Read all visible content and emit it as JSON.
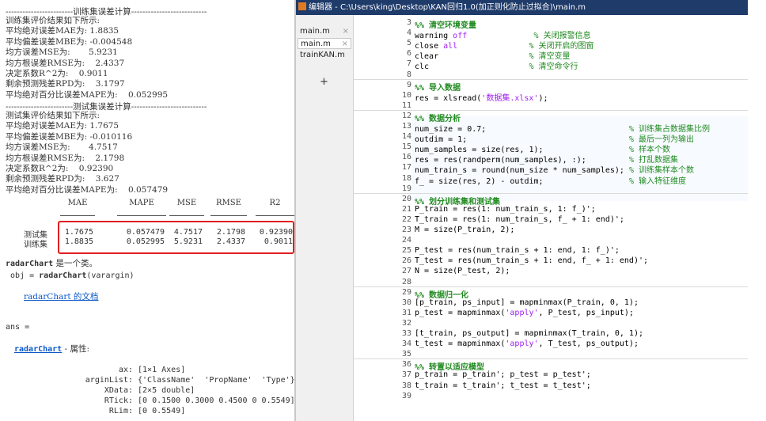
{
  "command_window": {
    "train_header": "------------------------训练集误差计算---------------------------",
    "train_lines": [
      "训练集评价结果如下所示:",
      "平均绝对误差MAE为: 1.8835",
      "平均偏差误差MBE为: -0.004548",
      "均方误差MSE为:       5.9231",
      "均方根误差RMSE为:    2.4337",
      "决定系数R^2为:    0.9011",
      "剩余预测残差RPD为:    3.1797",
      "平均绝对百分比误差MAPE为:    0.052995"
    ],
    "test_header": "------------------------测试集误差计算---------------------------",
    "test_lines": [
      "测试集评价结果如下所示:",
      "平均绝对误差MAE为: 1.7675",
      "平均偏差误差MBE为: -0.010116",
      "均方误差MSE为:       4.7517",
      "均方根误差RMSE为:    2.1798",
      "决定系数R^2为:    0.92390",
      "剩余预测残差RPD为:    3.627",
      "平均绝对百分比误差MAPE为:    0.057479"
    ],
    "table": {
      "columns": [
        "MAE",
        "MAPE",
        "MSE",
        "RMSE",
        "R2"
      ],
      "rows": [
        {
          "label": "测试集",
          "values": [
            "1.7675",
            "0.057479",
            "4.7517",
            "2.1798",
            "0.92390"
          ]
        },
        {
          "label": "训练集",
          "values": [
            "1.8835",
            "0.052995",
            "5.9231",
            "2.4337",
            "0.9011"
          ]
        }
      ]
    },
    "radar_desc_name": "radarChart",
    "radar_desc_rest": " 是一个类。",
    "radar_sig_prefix": " obj = ",
    "radar_sig_name": "radarChart",
    "radar_sig_suffix": "(varargin)",
    "radar_doc_link": "radarChart 的文档",
    "ans_line": "ans =",
    "ans_class_name": "radarChart",
    "ans_class_rest": " - 属性:",
    "props": [
      "ax: [1×1 Axes]",
      "arginList: {'ClassName'  'PropName'  'Type'}",
      "XData: [2×5 double]",
      "RTick: [0 0.1500 0.3000 0.4500 0 0.5549]",
      "RLim: [0 0.5549]"
    ]
  },
  "editor": {
    "title": "编辑器 - C:\\Users\\king\\Desktop\\KAN回归1.0(加正则化防止过拟合)\\main.m",
    "file_tabs": [
      {
        "name": "main.m",
        "active": false
      },
      {
        "name": "main.m",
        "active": true
      },
      {
        "name": "trainKAN.m",
        "active": false
      }
    ],
    "add_tab": "+",
    "close_glyph": "×",
    "lines": [
      {
        "n": "3",
        "parts": [
          [
            "hdr",
            "%% 清空环境变量"
          ]
        ]
      },
      {
        "n": "4",
        "parts": [
          [
            "",
            "warning "
          ],
          [
            "str",
            "off"
          ],
          [
            "",
            "              "
          ],
          [
            "cm",
            "% 关闭报警信息"
          ]
        ]
      },
      {
        "n": "5",
        "parts": [
          [
            "",
            "close "
          ],
          [
            "str",
            "all"
          ],
          [
            "",
            "               "
          ],
          [
            "cm",
            "% 关闭开启的图窗"
          ]
        ]
      },
      {
        "n": "6",
        "parts": [
          [
            "",
            "clear                   "
          ],
          [
            "cm",
            "% 清空变量"
          ]
        ]
      },
      {
        "n": "7",
        "parts": [
          [
            "",
            "clc                     "
          ],
          [
            "cm",
            "% 清空命令行"
          ]
        ]
      },
      {
        "n": "8",
        "parts": []
      },
      {
        "n": "9",
        "parts": [
          [
            "hdr",
            "%% 导入数据"
          ]
        ]
      },
      {
        "n": "10",
        "parts": [
          [
            "",
            "res = xlsread("
          ],
          [
            "str",
            "'数据集.xlsx'"
          ],
          [
            "",
            ");"
          ]
        ]
      },
      {
        "n": "11",
        "parts": []
      },
      {
        "n": "12",
        "parts": [
          [
            "hdr",
            "%% 数据分析"
          ]
        ]
      },
      {
        "n": "13",
        "parts": [
          [
            "",
            "num_size = 0.7;                              "
          ],
          [
            "cm",
            "% 训练集占数据集比例"
          ]
        ]
      },
      {
        "n": "14",
        "parts": [
          [
            "",
            "outdim = 1;                                  "
          ],
          [
            "cm",
            "% 最后一列为输出"
          ]
        ]
      },
      {
        "n": "15",
        "parts": [
          [
            "",
            "num_samples = size(res, 1);                  "
          ],
          [
            "cm",
            "% 样本个数"
          ]
        ]
      },
      {
        "n": "16",
        "parts": [
          [
            "",
            "res = res(randperm(num_samples), :);         "
          ],
          [
            "cm",
            "% 打乱数据集"
          ]
        ]
      },
      {
        "n": "17",
        "parts": [
          [
            "",
            "num_train_s = round(num_size * num_samples); "
          ],
          [
            "cm",
            "% 训练集样本个数"
          ]
        ]
      },
      {
        "n": "18",
        "parts": [
          [
            "",
            "f_ = size(res, 2) - outdim;                  "
          ],
          [
            "cm",
            "% 输入特征维度"
          ]
        ]
      },
      {
        "n": "19",
        "parts": []
      },
      {
        "n": "20",
        "parts": [
          [
            "hdr",
            "%% 划分训练集和测试集"
          ]
        ]
      },
      {
        "n": "21",
        "parts": [
          [
            "",
            "P_train = res(1: num_train_s, 1: f_)';"
          ]
        ]
      },
      {
        "n": "22",
        "parts": [
          [
            "",
            "T_train = res(1: num_train_s, f_ + 1: end)';"
          ]
        ]
      },
      {
        "n": "23",
        "parts": [
          [
            "",
            "M = size(P_train, 2);"
          ]
        ]
      },
      {
        "n": "24",
        "parts": []
      },
      {
        "n": "25",
        "parts": [
          [
            "",
            "P_test = res(num_train_s + 1: end, 1: f_)';"
          ]
        ]
      },
      {
        "n": "26",
        "parts": [
          [
            "",
            "T_test = res(num_train_s + 1: end, f_ + 1: end)';"
          ]
        ]
      },
      {
        "n": "27",
        "parts": [
          [
            "",
            "N = size(P_test, 2);"
          ]
        ]
      },
      {
        "n": "28",
        "parts": []
      },
      {
        "n": "29",
        "parts": [
          [
            "hdr",
            "%% 数据归一化"
          ]
        ]
      },
      {
        "n": "30",
        "parts": [
          [
            "",
            "[p_train, ps_input] = mapminmax(P_train, 0, 1);"
          ]
        ]
      },
      {
        "n": "31",
        "parts": [
          [
            "",
            "p_test = mapminmax("
          ],
          [
            "str",
            "'apply'"
          ],
          [
            "",
            ", P_test, ps_input);"
          ]
        ]
      },
      {
        "n": "32",
        "parts": []
      },
      {
        "n": "33",
        "parts": [
          [
            "",
            "[t_train, ps_output] = mapminmax(T_train, 0, 1);"
          ]
        ]
      },
      {
        "n": "34",
        "parts": [
          [
            "",
            "t_test = mapminmax("
          ],
          [
            "str",
            "'apply'"
          ],
          [
            "",
            ", T_test, ps_output);"
          ]
        ]
      },
      {
        "n": "35",
        "parts": []
      },
      {
        "n": "36",
        "parts": [
          [
            "hdr",
            "%% 转置以适应模型"
          ]
        ]
      },
      {
        "n": "37",
        "parts": [
          [
            "",
            "p_train = p_train'; p_test = p_test';"
          ]
        ]
      },
      {
        "n": "38",
        "parts": [
          [
            "",
            "t_train = t_train'; t_test = t_test';"
          ]
        ]
      },
      {
        "n": "39",
        "parts": []
      }
    ]
  }
}
